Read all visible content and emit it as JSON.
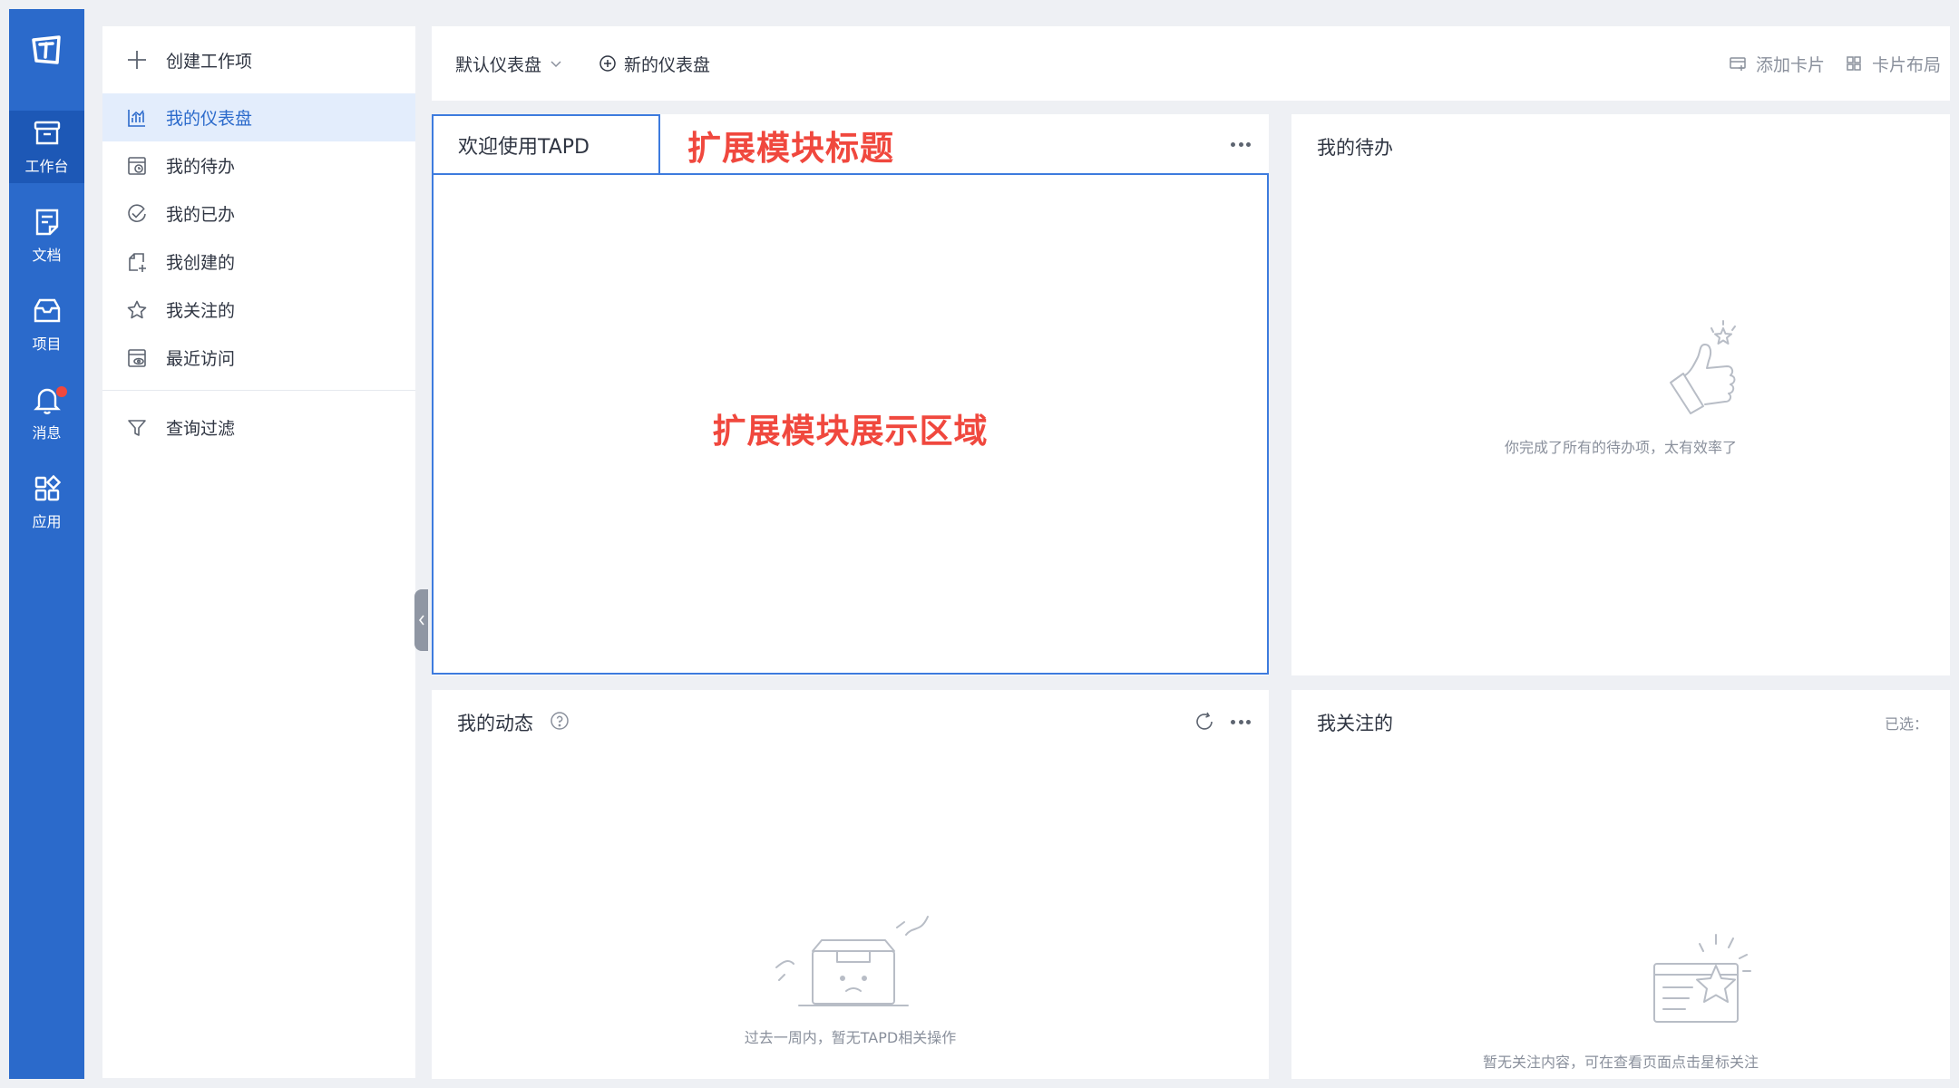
{
  "rail": {
    "items": [
      {
        "label": "工作台",
        "icon": "workbench-icon"
      },
      {
        "label": "文档",
        "icon": "document-icon"
      },
      {
        "label": "项目",
        "icon": "project-icon"
      },
      {
        "label": "消息",
        "icon": "bell-icon"
      },
      {
        "label": "应用",
        "icon": "apps-icon"
      }
    ],
    "active_index": 0,
    "notification_dot": true
  },
  "sidebar": {
    "create_label": "创建工作项",
    "items": [
      {
        "label": "我的仪表盘",
        "icon": "chart-icon",
        "active": true
      },
      {
        "label": "我的待办",
        "icon": "todo-icon"
      },
      {
        "label": "我的已办",
        "icon": "check-circle-icon"
      },
      {
        "label": "我创建的",
        "icon": "created-icon"
      },
      {
        "label": "我关注的",
        "icon": "star-icon"
      },
      {
        "label": "最近访问",
        "icon": "recent-icon"
      }
    ],
    "filter_label": "查询过滤"
  },
  "topbar": {
    "dashboard_select": "默认仪表盘",
    "new_dashboard": "新的仪表盘",
    "add_card": "添加卡片",
    "card_layout": "卡片布局"
  },
  "cards": {
    "welcome": {
      "tab_label": "欢迎使用TAPD",
      "ext_title": "扩展模块标题",
      "ext_area": "扩展模块展示区域"
    },
    "todo": {
      "title": "我的待办",
      "empty": "你完成了所有的待办项，太有效率了"
    },
    "activity": {
      "title": "我的动态",
      "empty": "过去一周内，暂无TAPD相关操作"
    },
    "following": {
      "title": "我关注的",
      "selected": "已选：",
      "empty": "暂无关注内容，可在查看页面点击星标关注"
    }
  },
  "colors": {
    "rail": "#2b6acb",
    "accent": "#3d7bde",
    "annotation": "#f0483e"
  }
}
